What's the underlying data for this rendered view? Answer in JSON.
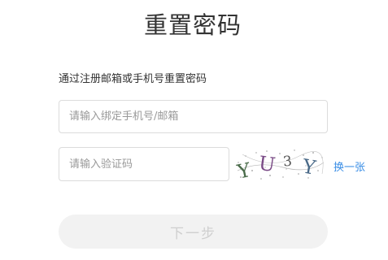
{
  "page": {
    "title": "重置密码",
    "subtitle": "通过注册邮箱或手机号重置密码"
  },
  "form": {
    "account": {
      "value": "",
      "placeholder": "请输入绑定手机号/邮箱"
    },
    "verify_code": {
      "value": "",
      "placeholder": "请输入验证码"
    },
    "captcha": {
      "chars": [
        "Y",
        "U",
        "3",
        "Y"
      ],
      "refresh_label": "换一张"
    },
    "next_label": "下一步"
  },
  "colors": {
    "link": "#3a8ee6",
    "button_bg": "#f2f2f2",
    "button_text": "#cfcfcf",
    "border": "#dcdcdc"
  }
}
